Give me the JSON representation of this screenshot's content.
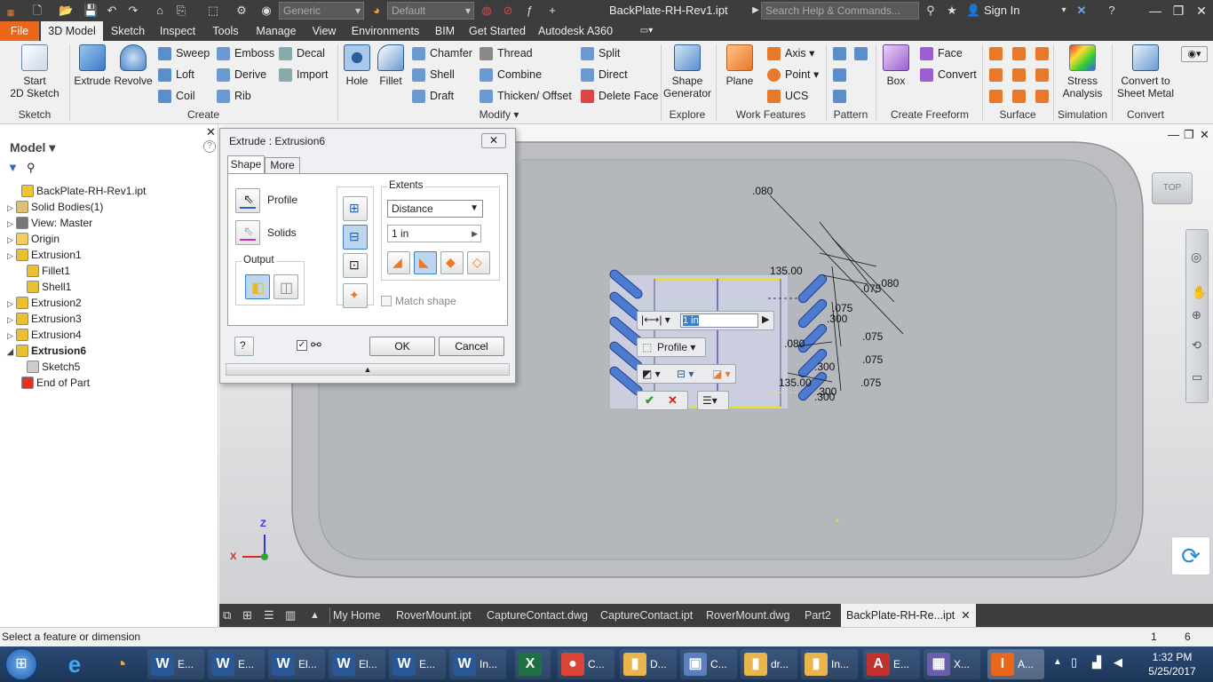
{
  "titlebar": {
    "doc_title": "BackPlate-RH-Rev1.ipt",
    "appearance_combo": "Generic",
    "material_combo": "Default",
    "search_placeholder": "Search Help & Commands...",
    "signin": "Sign In"
  },
  "ribbon_tabs": [
    "File",
    "3D Model",
    "Sketch",
    "Inspect",
    "Tools",
    "Manage",
    "View",
    "Environments",
    "BIM",
    "Get Started",
    "Autodesk A360"
  ],
  "ribbon": {
    "sketch": {
      "start_sketch_line1": "Start",
      "start_sketch_line2": "2D Sketch",
      "panel": "Sketch"
    },
    "create": {
      "extrude": "Extrude",
      "revolve": "Revolve",
      "sweep": "Sweep",
      "loft": "Loft",
      "coil": "Coil",
      "emboss": "Emboss",
      "derive": "Derive",
      "rib": "Rib",
      "decal": "Decal",
      "import": "Import",
      "panel": "Create"
    },
    "modify": {
      "hole": "Hole",
      "fillet": "Fillet",
      "chamfer": "Chamfer",
      "shell": "Shell",
      "draft": "Draft",
      "thread": "Thread",
      "combine": "Combine",
      "thicken": "Thicken/ Offset",
      "split": "Split",
      "direct": "Direct",
      "delete_face": "Delete Face",
      "panel": "Modify"
    },
    "explore": {
      "shape_gen_line1": "Shape",
      "shape_gen_line2": "Generator",
      "panel": "Explore"
    },
    "work": {
      "plane": "Plane",
      "axis": "Axis",
      "point": "Point",
      "ucs": "UCS",
      "panel": "Work Features"
    },
    "pattern": {
      "panel": "Pattern"
    },
    "freeform": {
      "box": "Box",
      "face": "Face",
      "convert": "Convert",
      "panel": "Create Freeform"
    },
    "surface": {
      "panel": "Surface"
    },
    "simulation": {
      "stress_line1": "Stress",
      "stress_line2": "Analysis",
      "panel": "Simulation"
    },
    "convert": {
      "sheet_line1": "Convert to",
      "sheet_line2": "Sheet Metal",
      "panel": "Convert"
    }
  },
  "browser": {
    "header": "Model",
    "items": [
      {
        "label": "BackPlate-RH-Rev1.ipt",
        "color": "#f2c230",
        "toggle": ""
      },
      {
        "label": "Solid Bodies(1)",
        "color": "#e0c070",
        "toggle": "▷"
      },
      {
        "label": "View: Master",
        "color": "#777",
        "toggle": "▷"
      },
      {
        "label": "Origin",
        "color": "#f3cf5a",
        "toggle": "▷"
      },
      {
        "label": "Extrusion1",
        "color": "#e8c030",
        "toggle": "▷"
      },
      {
        "label": "Fillet1",
        "color": "#e8c030",
        "toggle": ""
      },
      {
        "label": "Shell1",
        "color": "#e8c030",
        "toggle": ""
      },
      {
        "label": "Extrusion2",
        "color": "#e8c030",
        "toggle": "▷"
      },
      {
        "label": "Extrusion3",
        "color": "#e8c030",
        "toggle": "▷"
      },
      {
        "label": "Extrusion4",
        "color": "#e8c030",
        "toggle": "▷"
      },
      {
        "label": "Extrusion6",
        "color": "#e8c030",
        "toggle": "◢"
      },
      {
        "label": "Sketch5",
        "color": "#ccc",
        "toggle": ""
      },
      {
        "label": "End of Part",
        "color": "#d33",
        "toggle": ""
      }
    ]
  },
  "dialog": {
    "title": "Extrude : Extrusion6",
    "tabs": [
      "Shape",
      "More"
    ],
    "profile": "Profile",
    "solids": "Solids",
    "output": "Output",
    "extents": "Extents",
    "extent_type": "Distance",
    "distance": "1 in",
    "match_shape": "Match shape",
    "ok": "OK",
    "cancel": "Cancel"
  },
  "mini_toolbar": {
    "distance": "1 in",
    "profile": "Profile"
  },
  "dimensions": [
    ".080",
    "135.00",
    ".075",
    ".080",
    ".075",
    ".300",
    ".075",
    ".080",
    ".300",
    ".075",
    ".300",
    ".075",
    "135.00",
    ".300"
  ],
  "viewcube": "TOP",
  "bottom_tabs": [
    "My Home",
    "RoverMount.ipt",
    "CaptureContact.dwg",
    "CaptureContact.ipt",
    "RoverMount.dwg",
    "Part2",
    "BackPlate-RH-Re...ipt"
  ],
  "status": {
    "message": "Select a feature or dimension",
    "count1": "1",
    "count2": "6"
  },
  "taskbar": {
    "apps": [
      {
        "label": "E...",
        "letter": "W",
        "color": "#2b5797"
      },
      {
        "label": "E...",
        "letter": "W",
        "color": "#2b5797"
      },
      {
        "label": "El...",
        "letter": "W",
        "color": "#2b5797"
      },
      {
        "label": "El...",
        "letter": "W",
        "color": "#2b5797"
      },
      {
        "label": "E...",
        "letter": "W",
        "color": "#2b5797"
      },
      {
        "label": "In...",
        "letter": "W",
        "color": "#2b5797"
      },
      {
        "label": "",
        "letter": "X",
        "color": "#1e7145"
      },
      {
        "label": "C...",
        "letter": "●",
        "color": "#db4437"
      },
      {
        "label": "D...",
        "letter": "▮",
        "color": "#e8b64a"
      },
      {
        "label": "C...",
        "letter": "▣",
        "color": "#5b7fbf"
      },
      {
        "label": "dr...",
        "letter": "▮",
        "color": "#e8b64a"
      },
      {
        "label": "In...",
        "letter": "▮",
        "color": "#e8b64a"
      },
      {
        "label": "E...",
        "letter": "A",
        "color": "#c0322f"
      },
      {
        "label": "X...",
        "letter": "▦",
        "color": "#6a5fa8"
      },
      {
        "label": "A...",
        "letter": "I",
        "color": "#e8671a"
      }
    ],
    "time": "1:32 PM",
    "date": "5/25/2017"
  },
  "colors": {
    "accent": "#e8671a",
    "dark": "#3d3d3d",
    "select_blue": "#3c7fc4"
  }
}
